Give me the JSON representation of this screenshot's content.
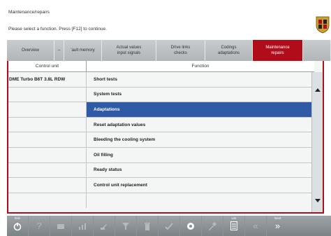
{
  "header": {
    "title": "Maintenance/repairs",
    "instruction": "Please select a function. Press [F12] to continue."
  },
  "tabs": [
    {
      "label": "Overview",
      "active": false
    },
    {
      "label": "–",
      "active": false
    },
    {
      "label": "'ault memory",
      "active": false
    },
    {
      "label": "Actual values\ninput signals",
      "active": false
    },
    {
      "label": "Drive links\nchecks",
      "active": false
    },
    {
      "label": "Codings\nadaptations",
      "active": false
    },
    {
      "label": "Maintenance\nrepairs",
      "active": true
    }
  ],
  "table": {
    "headers": {
      "control_unit": "Control unit",
      "function": "Function"
    },
    "rows": [
      {
        "control_unit": "DME Turbo B6T 3.8L RDW",
        "function": "Short tests"
      },
      {
        "control_unit": "",
        "function": "System tests"
      },
      {
        "control_unit": "",
        "function": "Adaptations"
      },
      {
        "control_unit": "",
        "function": "Reset adaptation values"
      },
      {
        "control_unit": "",
        "function": "Bleeding the cooling system"
      },
      {
        "control_unit": "",
        "function": "Oil filling"
      },
      {
        "control_unit": "",
        "function": "Ready status"
      },
      {
        "control_unit": "",
        "function": "Control unit replacement"
      },
      {
        "control_unit": "",
        "function": ""
      }
    ],
    "selected_index": 2
  },
  "toolbar": {
    "buttons": [
      {
        "name": "exit-icon",
        "label": "Exit",
        "enabled": true
      },
      {
        "name": "help-icon",
        "label": "",
        "enabled": false
      },
      {
        "name": "print-icon",
        "label": "",
        "enabled": false
      },
      {
        "name": "chart-icon",
        "label": "",
        "enabled": false
      },
      {
        "name": "edit-icon",
        "label": "",
        "enabled": false
      },
      {
        "name": "filter-icon",
        "label": "",
        "enabled": false
      },
      {
        "name": "delete-icon",
        "label": "",
        "enabled": false
      },
      {
        "name": "check-icon",
        "label": "",
        "enabled": false
      },
      {
        "name": "record-icon",
        "label": "",
        "enabled": false
      },
      {
        "name": "tools-icon",
        "label": "",
        "enabled": false
      },
      {
        "name": "list-icon",
        "label": "List",
        "enabled": true
      },
      {
        "name": "back-icon",
        "label": "",
        "enabled": false
      },
      {
        "name": "next-icon",
        "label": "Next",
        "enabled": true
      }
    ]
  },
  "colors": {
    "accent": "#b00c1a",
    "selection": "#2f5aa6",
    "tab_bg": "#b9bdc0",
    "toolbar_bg": "#8a9094"
  }
}
